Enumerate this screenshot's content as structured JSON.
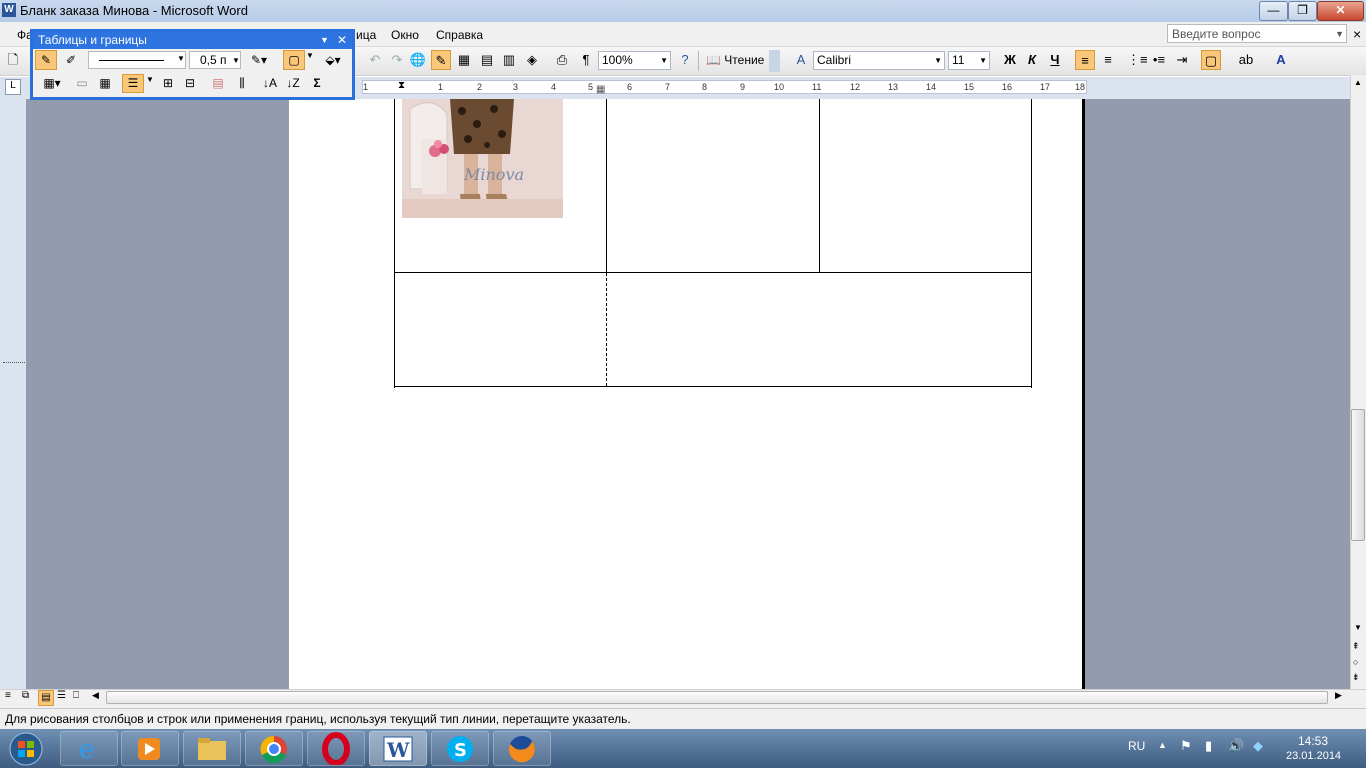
{
  "window": {
    "title": "Бланк заказа Минова - Microsoft Word",
    "word_icon": "W"
  },
  "caption_buttons": {
    "minimize": "—",
    "restore": "❐",
    "close": "✕"
  },
  "menu": {
    "items": [
      "Фа",
      "ица",
      "Окно",
      "Справка"
    ],
    "ask_placeholder": "Введите вопрос",
    "close": "×"
  },
  "toolbar": {
    "zoom": "100%",
    "reading_label": "Чтение",
    "font": "Calibri",
    "size": "11",
    "bold": "Ж",
    "italic": "К",
    "underline": "Ч",
    "pilcrow": "¶"
  },
  "floating_toolbar": {
    "title": "Таблицы и границы",
    "line_weight": "0,5 п",
    "sum": "Σ"
  },
  "ruler": {
    "numbers": [
      "1",
      "1",
      "2",
      "3",
      "4",
      "5",
      "6",
      "7",
      "8",
      "9",
      "10",
      "11",
      "12",
      "13",
      "14",
      "15",
      "16",
      "17",
      "18"
    ]
  },
  "image_watermark": "Minova",
  "status": {
    "text": "Для рисования столбцов и строк или применения границ, используя текущий тип линии, перетащите указатель."
  },
  "taskbar": {
    "lang": "RU",
    "time": "14:53",
    "date": "23.01.2014",
    "apps": [
      "ie-icon",
      "media-player-icon",
      "explorer-icon",
      "chrome-icon",
      "opera-icon",
      "word-icon",
      "skype-icon",
      "firefox-icon"
    ]
  }
}
